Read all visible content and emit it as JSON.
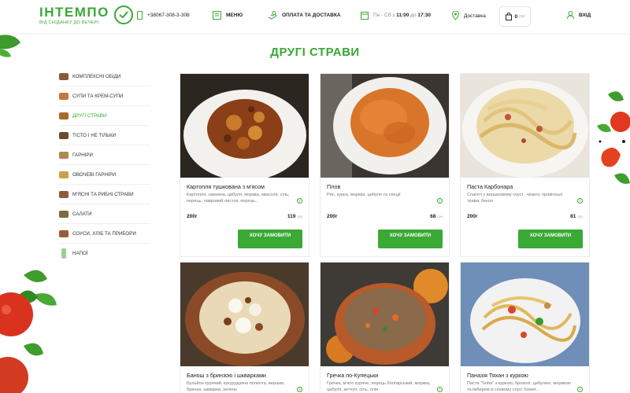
{
  "header": {
    "logo_name": "ІНТЕМПО",
    "logo_tagline": "ВІД СНІДАНКУ ДО ВЕЧЕРІ",
    "phone": "+38067-308-3-308",
    "menu_label": "МЕНЮ",
    "payment_label": "ОПЛАТА ТА ДОСТАВКА",
    "hours_prefix": "Пн - Сб з",
    "hours_from": "11:00",
    "hours_mid": "до",
    "hours_to": "17:30",
    "delivery_label": "Доставка",
    "cart_count": "0",
    "cart_currency": "грн",
    "login_label": "ВХІД"
  },
  "page_title": "ДРУГІ СТРАВИ",
  "sidebar": {
    "items": [
      {
        "label": "КОМПЛЕКСНІ ОБІДИ",
        "active": false
      },
      {
        "label": "СУПИ ТА КРЕМ-СУПИ",
        "active": false
      },
      {
        "label": "ДРУГІ СТРАВИ",
        "active": true
      },
      {
        "label": "ТІСТО І НЕ ТІЛЬКИ",
        "active": false
      },
      {
        "label": "ГАРНІРИ",
        "active": false
      },
      {
        "label": "ОВОЧЕВІ ГАРНІРИ",
        "active": false
      },
      {
        "label": "М'ЯСНІ ТА РИБНІ СТРАВИ",
        "active": false
      },
      {
        "label": "САЛАТИ",
        "active": false
      },
      {
        "label": "СОУСИ, ХЛІБ ТА ПРИБОРИ",
        "active": false
      },
      {
        "label": "НАПОЇ",
        "active": false
      }
    ]
  },
  "products": [
    {
      "name": "Картопля тушкована з м'ясом",
      "desc": "Картопля, свинина, цибуля, морква, квасоля, сіль, перець, лавровий листок, перець...",
      "weight": "200г",
      "price": "119",
      "currency": "грн",
      "button": "ХОЧУ ЗАМОВИТИ"
    },
    {
      "name": "Плов",
      "desc": "Рис, курка, морква, цибуля та спеції",
      "weight": "200г",
      "price": "68",
      "currency": "грн",
      "button": "ХОЧУ ЗАМОВИТИ"
    },
    {
      "name": "Паста Карбонара",
      "desc": "Спагеті у вершковому соусі , чизилі, провінські трави, бекон",
      "weight": "200г",
      "price": "81",
      "currency": "грн",
      "button": "ХОЧУ ЗАМОВИТИ"
    },
    {
      "name": "Банош з бринзою і шкварками",
      "desc": "Бульйон курячий, кукурудзяна полента, вершки, бринза, шкварки, зелень"
    },
    {
      "name": "Гречка по-Купецьки",
      "desc": "Гречка, м'ясо куряче, перець болгарський, морква, цибуля, кетчуп, сіль, олія"
    },
    {
      "name": "Паназія Тяхан з куркою",
      "desc": "Паста \"Soba\" з куркою, броколі, цибулею, морквою та імбирем в соєвому соусі Sweet..."
    }
  ]
}
